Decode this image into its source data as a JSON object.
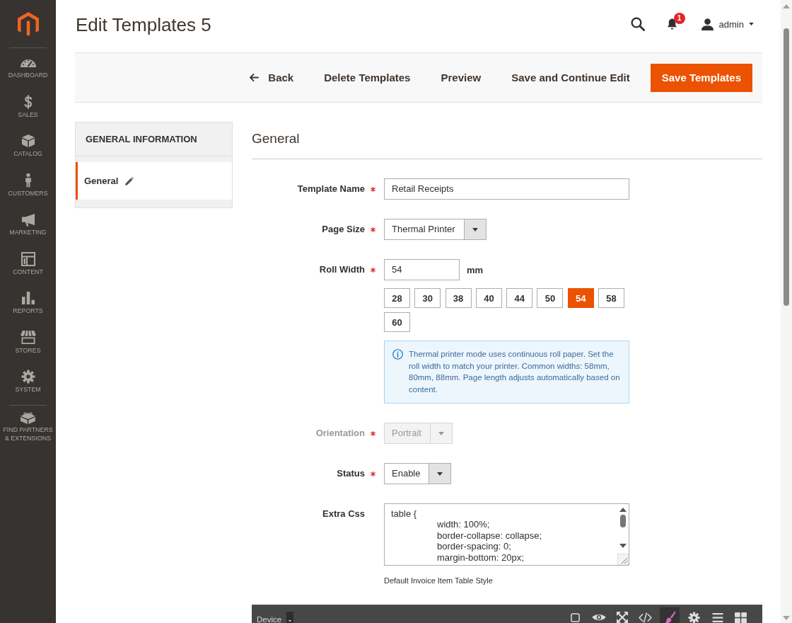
{
  "sidebar": {
    "items": [
      {
        "label": "DASHBOARD",
        "selected": false
      },
      {
        "label": "SALES",
        "selected": false
      },
      {
        "label": "CATALOG",
        "selected": false
      },
      {
        "label": "CUSTOMERS",
        "selected": false
      },
      {
        "label": "MARKETING",
        "selected": false
      },
      {
        "label": "CONTENT",
        "selected": false
      },
      {
        "label": "REPORTS",
        "selected": false
      },
      {
        "label": "STORES",
        "selected": false
      },
      {
        "label": "SYSTEM",
        "selected": false
      }
    ],
    "extensions_link": {
      "label": "FIND PARTNERS & EXTENSIONS"
    }
  },
  "header": {
    "title": "Edit Templates 5",
    "notifications": {
      "count": "1"
    },
    "user": {
      "name": "admin"
    }
  },
  "actions": [
    {
      "label": "Back",
      "kind": "back"
    },
    {
      "label": "Delete Templates",
      "kind": "link"
    },
    {
      "label": "Preview",
      "kind": "link"
    },
    {
      "label": "Save and Continue Edit",
      "kind": "link"
    },
    {
      "label": "Save Templates",
      "kind": "primary"
    }
  ],
  "tabs": {
    "title": "GENERAL INFORMATION",
    "items": [
      {
        "label": "General",
        "selected": true
      }
    ]
  },
  "form": {
    "heading": "General",
    "fields": [
      {
        "kind": "text",
        "label": "Template Name",
        "required": true,
        "disabled": false,
        "value": "Retail Receipts"
      },
      {
        "kind": "select",
        "label": "Page Size",
        "required": true,
        "disabled": false,
        "value": "Thermal Printer"
      },
      {
        "kind": "roll_width",
        "label": "Roll Width",
        "required": true,
        "disabled": false,
        "value": "54",
        "unit": "mm",
        "options": [
          {
            "label": "28",
            "selected": false
          },
          {
            "label": "30",
            "selected": false
          },
          {
            "label": "38",
            "selected": false
          },
          {
            "label": "40",
            "selected": false
          },
          {
            "label": "44",
            "selected": false
          },
          {
            "label": "50",
            "selected": false
          },
          {
            "label": "54",
            "selected": true
          },
          {
            "label": "58",
            "selected": false
          },
          {
            "label": "60",
            "selected": false
          }
        ],
        "note": "Thermal printer mode uses continuous roll paper. Set the roll width to match your printer. Common widths: 58mm, 80mm, 88mm. Page length adjusts automatically based on content."
      },
      {
        "kind": "select",
        "label": "Orientation",
        "required": true,
        "disabled": true,
        "value": "Portrait"
      },
      {
        "kind": "select",
        "label": "Status",
        "required": true,
        "disabled": false,
        "value": "Enable"
      },
      {
        "kind": "textarea",
        "label": "Extra Css",
        "required": false,
        "disabled": false,
        "value": "table {\n\twidth: 100%;\n\tborder-collapse: collapse;\n\tborder-spacing: 0;\n\tmargin-bottom: 20px;",
        "hint": "Default Invoice Item Table Style"
      }
    ]
  },
  "editor_toolbar": {
    "device_menu": {
      "label": "Device"
    },
    "tools": [
      {
        "selected": false
      },
      {
        "selected": false
      },
      {
        "selected": false
      },
      {
        "selected": false
      },
      {
        "selected": true
      },
      {
        "selected": false
      },
      {
        "selected": false
      },
      {
        "selected": false
      }
    ]
  }
}
